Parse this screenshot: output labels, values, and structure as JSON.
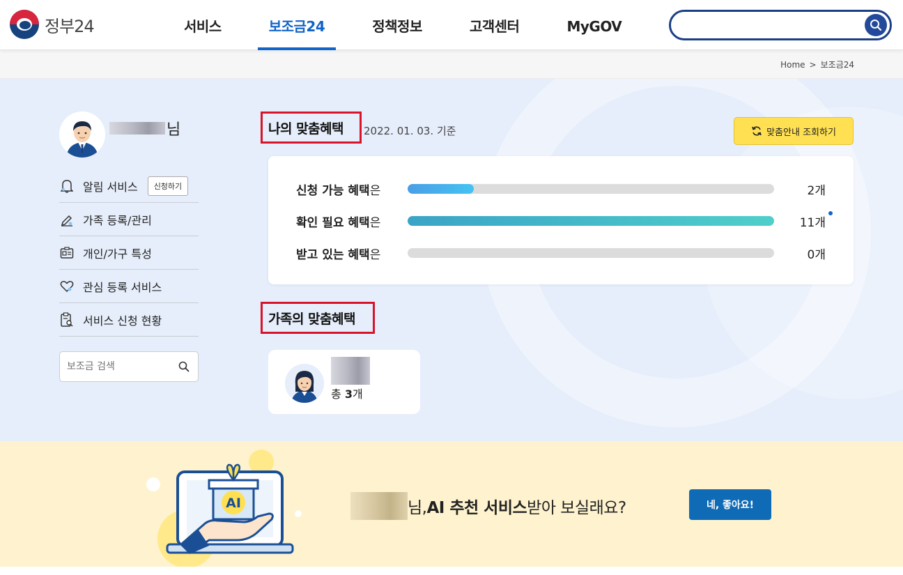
{
  "header": {
    "logo_text": "정부24",
    "nav": [
      {
        "label": "서비스",
        "active": false
      },
      {
        "label": "보조금24",
        "active": true
      },
      {
        "label": "정책정보",
        "active": false
      },
      {
        "label": "고객센터",
        "active": false
      },
      {
        "label": "MyGOV",
        "active": false
      }
    ],
    "search_placeholder": ""
  },
  "breadcrumb": {
    "home": "Home",
    "separator": ">",
    "current": "보조금24"
  },
  "sidebar": {
    "user_suffix": "님",
    "menu": [
      {
        "label": "알림 서비스",
        "icon": "bell-icon",
        "button": "신청하기"
      },
      {
        "label": "가족 등록/관리",
        "icon": "pencil-icon"
      },
      {
        "label": "개인/가구 특성",
        "icon": "id-card-icon"
      },
      {
        "label": "관심 등록 서비스",
        "icon": "heart-icon"
      },
      {
        "label": "서비스 신청 현황",
        "icon": "clipboard-search-icon"
      }
    ],
    "search_placeholder": "보조금 검색"
  },
  "my_benefits": {
    "title": "나의 맞춤혜택",
    "date": "2022. 01. 03. 기준",
    "refresh_label": "맞춤안내 조회하기",
    "rows": [
      {
        "label_bold": "신청 가능 혜택",
        "label_suffix": "은",
        "count": "2개",
        "fill": 0.18,
        "color_start": "#4a9ee6",
        "color_end": "#44c3f2"
      },
      {
        "label_bold": "확인 필요 혜택",
        "label_suffix": "은",
        "count": "11개",
        "fill": 1.0,
        "color_start": "#3aa4c6",
        "color_end": "#4fcfcb",
        "new_dot": true
      },
      {
        "label_bold": "받고 있는 혜택",
        "label_suffix": "은",
        "count": "0개",
        "fill": 0.0,
        "color_start": "#dcdcdc",
        "color_end": "#dcdcdc"
      }
    ]
  },
  "family_benefits": {
    "title": "가족의 맞춤혜택",
    "member": {
      "total_prefix": "총 ",
      "total_count": "3",
      "total_suffix": "개"
    }
  },
  "banner": {
    "name_suffix": "님, ",
    "highlight": "AI 추천 서비스",
    "rest": " 받아 보실래요?",
    "button": "네, 좋아요!",
    "illustration_text": "AI"
  },
  "colors": {
    "brand_blue": "#1164c8",
    "section_border": "#d8132a",
    "refresh_yellow": "#ffe052",
    "main_bg": "#e6eefb",
    "banner_bg": "#fef3ce",
    "banner_button": "#0f6bb5"
  }
}
